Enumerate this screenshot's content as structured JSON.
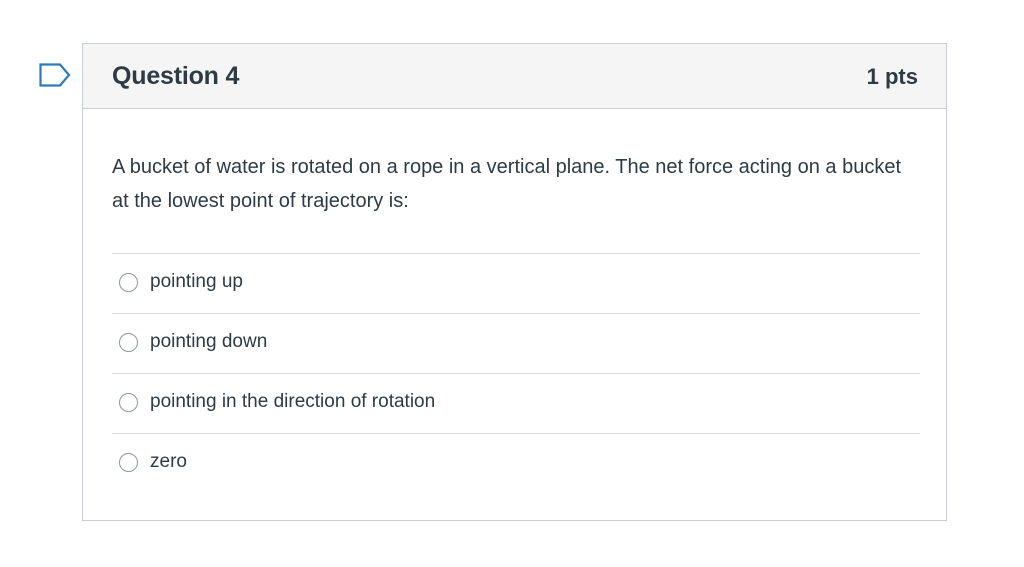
{
  "question": {
    "title": "Question 4",
    "points": "1 pts",
    "text": "A bucket of water is rotated on a rope in a vertical plane. The net force acting on a bucket at the lowest point of trajectory is:",
    "answers": [
      {
        "label": "pointing up"
      },
      {
        "label": "pointing down"
      },
      {
        "label": "pointing in the direction of rotation"
      },
      {
        "label": "zero"
      }
    ]
  },
  "colors": {
    "flag": "#2b7abc",
    "header_bg": "#f5f5f5",
    "border": "#c7cdd1",
    "text": "#2d3b45"
  },
  "icons": {
    "flag": "flag-question-icon",
    "radio": "radio-button-icon"
  }
}
